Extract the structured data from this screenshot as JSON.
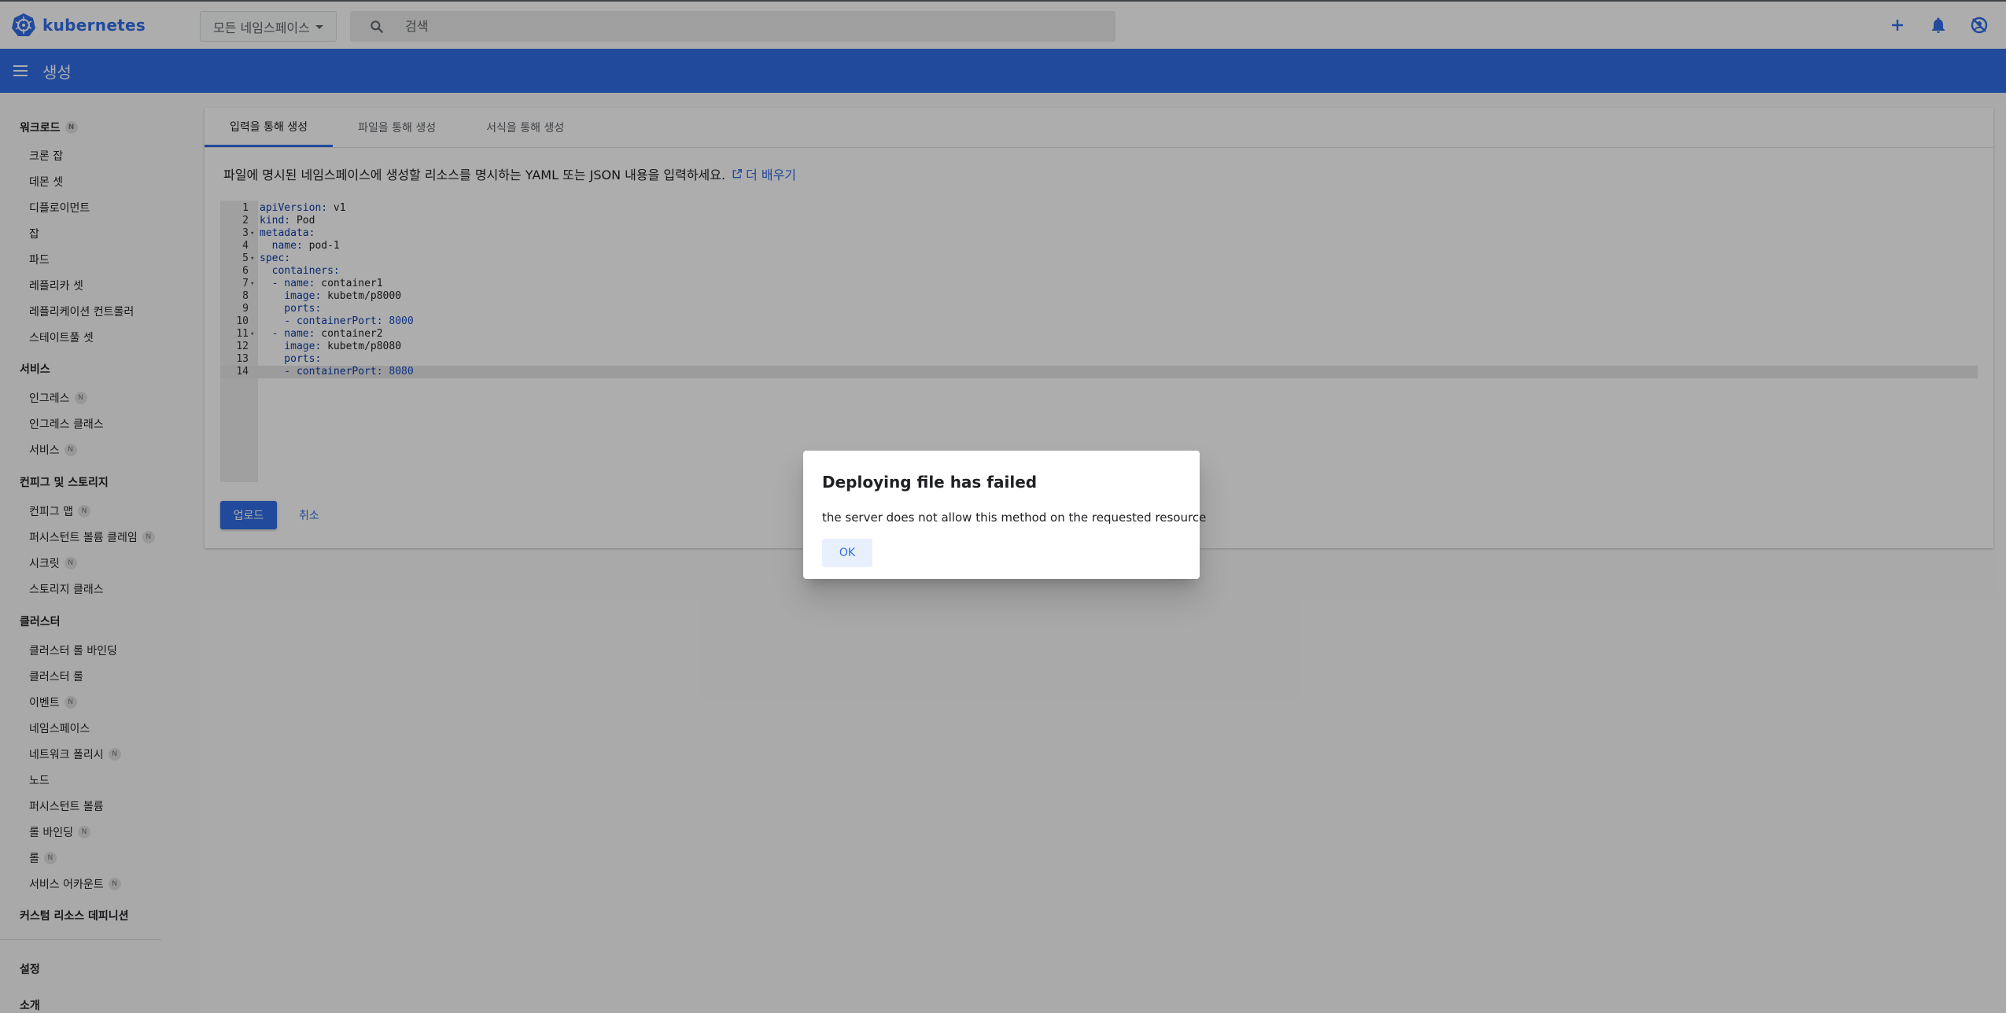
{
  "topbar": {
    "brand": "kubernetes",
    "namespace_select": "모든 네임스페이스",
    "search_placeholder": "검색"
  },
  "appbar": {
    "title": "생성"
  },
  "sidebar": {
    "groups": [
      {
        "label": "워크로드",
        "badge": "N"
      },
      {
        "label": "서비스"
      },
      {
        "label": "컨피그 및 스토리지"
      },
      {
        "label": "클러스터"
      },
      {
        "label": "커스텀 리소스 데피니션"
      },
      {
        "label": "설정"
      },
      {
        "label": "소개"
      }
    ],
    "items": [
      {
        "label": "크론 잡"
      },
      {
        "label": "데몬 셋"
      },
      {
        "label": "디플로이먼트"
      },
      {
        "label": "잡"
      },
      {
        "label": "파드"
      },
      {
        "label": "레플리카 셋"
      },
      {
        "label": "레플리케이션 컨트롤러"
      },
      {
        "label": "스테이트풀 셋"
      },
      {
        "label": "인그레스",
        "badge": "N"
      },
      {
        "label": "인그레스 클래스"
      },
      {
        "label": "서비스",
        "badge": "N"
      },
      {
        "label": "컨피그 맵",
        "badge": "N"
      },
      {
        "label": "퍼시스턴트 볼륨 클레임",
        "badge": "N"
      },
      {
        "label": "시크릿",
        "badge": "N"
      },
      {
        "label": "스토리지 클래스"
      },
      {
        "label": "클러스터 롤 바인딩"
      },
      {
        "label": "클러스터 롤"
      },
      {
        "label": "이벤트",
        "badge": "N"
      },
      {
        "label": "네임스페이스"
      },
      {
        "label": "네트워크 폴리시",
        "badge": "N"
      },
      {
        "label": "노드"
      },
      {
        "label": "퍼시스턴트 볼륨"
      },
      {
        "label": "롤 바인딩",
        "badge": "N"
      },
      {
        "label": "롤",
        "badge": "N"
      },
      {
        "label": "서비스 어카운트",
        "badge": "N"
      }
    ]
  },
  "tabs": [
    "입력을 통해 생성",
    "파일을 통해 생성",
    "서식을 통해 생성"
  ],
  "description": "파일에 명시된 네임스페이스에 생성할 리소스를 명시하는 YAML 또는 JSON 내용을 입력하세요.",
  "learn_more": "더 배우기",
  "editor": {
    "lines": [
      {
        "num": "1",
        "key": "apiVersion:",
        "val": " v1"
      },
      {
        "num": "2",
        "key": "kind:",
        "val": " Pod"
      },
      {
        "num": "3",
        "key": "metadata:",
        "val": "",
        "fold": true
      },
      {
        "num": "4",
        "key": "  name:",
        "val": " pod-1"
      },
      {
        "num": "5",
        "key": "spec:",
        "val": "",
        "fold": true
      },
      {
        "num": "6",
        "key": "  containers:",
        "val": ""
      },
      {
        "num": "7",
        "key": "  - name:",
        "val": " container1",
        "fold": true
      },
      {
        "num": "8",
        "key": "    image:",
        "val": " kubetm/p8000"
      },
      {
        "num": "9",
        "key": "    ports:",
        "val": ""
      },
      {
        "num": "10",
        "key": "    - containerPort:",
        "num_val": " 8000"
      },
      {
        "num": "11",
        "key": "  - name:",
        "val": " container2",
        "fold": true
      },
      {
        "num": "12",
        "key": "    image:",
        "val": " kubetm/p8080"
      },
      {
        "num": "13",
        "key": "    ports:",
        "val": ""
      },
      {
        "num": "14",
        "key": "    - containerPort:",
        "num_val": " 8080",
        "active": true
      }
    ]
  },
  "buttons": {
    "upload": "업로드",
    "cancel": "취소"
  },
  "dialog": {
    "title": "Deploying file has failed",
    "message": "the server does not allow this method on the requested resource",
    "ok": "OK"
  },
  "colors": {
    "brand": "#326de6"
  }
}
